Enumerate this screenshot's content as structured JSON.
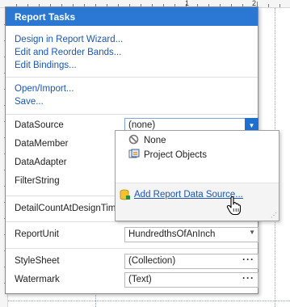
{
  "ruler": {
    "marks": [
      "1",
      "2"
    ]
  },
  "panel": {
    "title": "Report Tasks",
    "links": [
      "Design in Report Wizard...",
      "Edit and Reorder Bands...",
      "Edit Bindings...",
      "Open/Import...",
      "Save..."
    ],
    "properties": {
      "datasource": {
        "label": "DataSource",
        "value": "(none)"
      },
      "datamember": {
        "label": "DataMember"
      },
      "dataadapter": {
        "label": "DataAdapter"
      },
      "filterstring": {
        "label": "FilterString"
      },
      "detailcount": {
        "label": "DetailCountAtDesignTime"
      },
      "reportunit": {
        "label": "ReportUnit",
        "value": "HundredthsOfAnInch"
      },
      "stylesheet": {
        "label": "StyleSheet",
        "value": "(Collection)"
      },
      "watermark": {
        "label": "Watermark",
        "value": "(Text)"
      }
    }
  },
  "popup": {
    "items": [
      {
        "label": "None",
        "icon": "none-icon"
      },
      {
        "label": "Project Objects",
        "icon": "project-objects-icon"
      }
    ],
    "add_link": "Add Report Data Source..."
  },
  "colors": {
    "title_bar": "#2b78d4",
    "link": "#1a56b5",
    "dropdown_button": "#1f6fd1"
  }
}
